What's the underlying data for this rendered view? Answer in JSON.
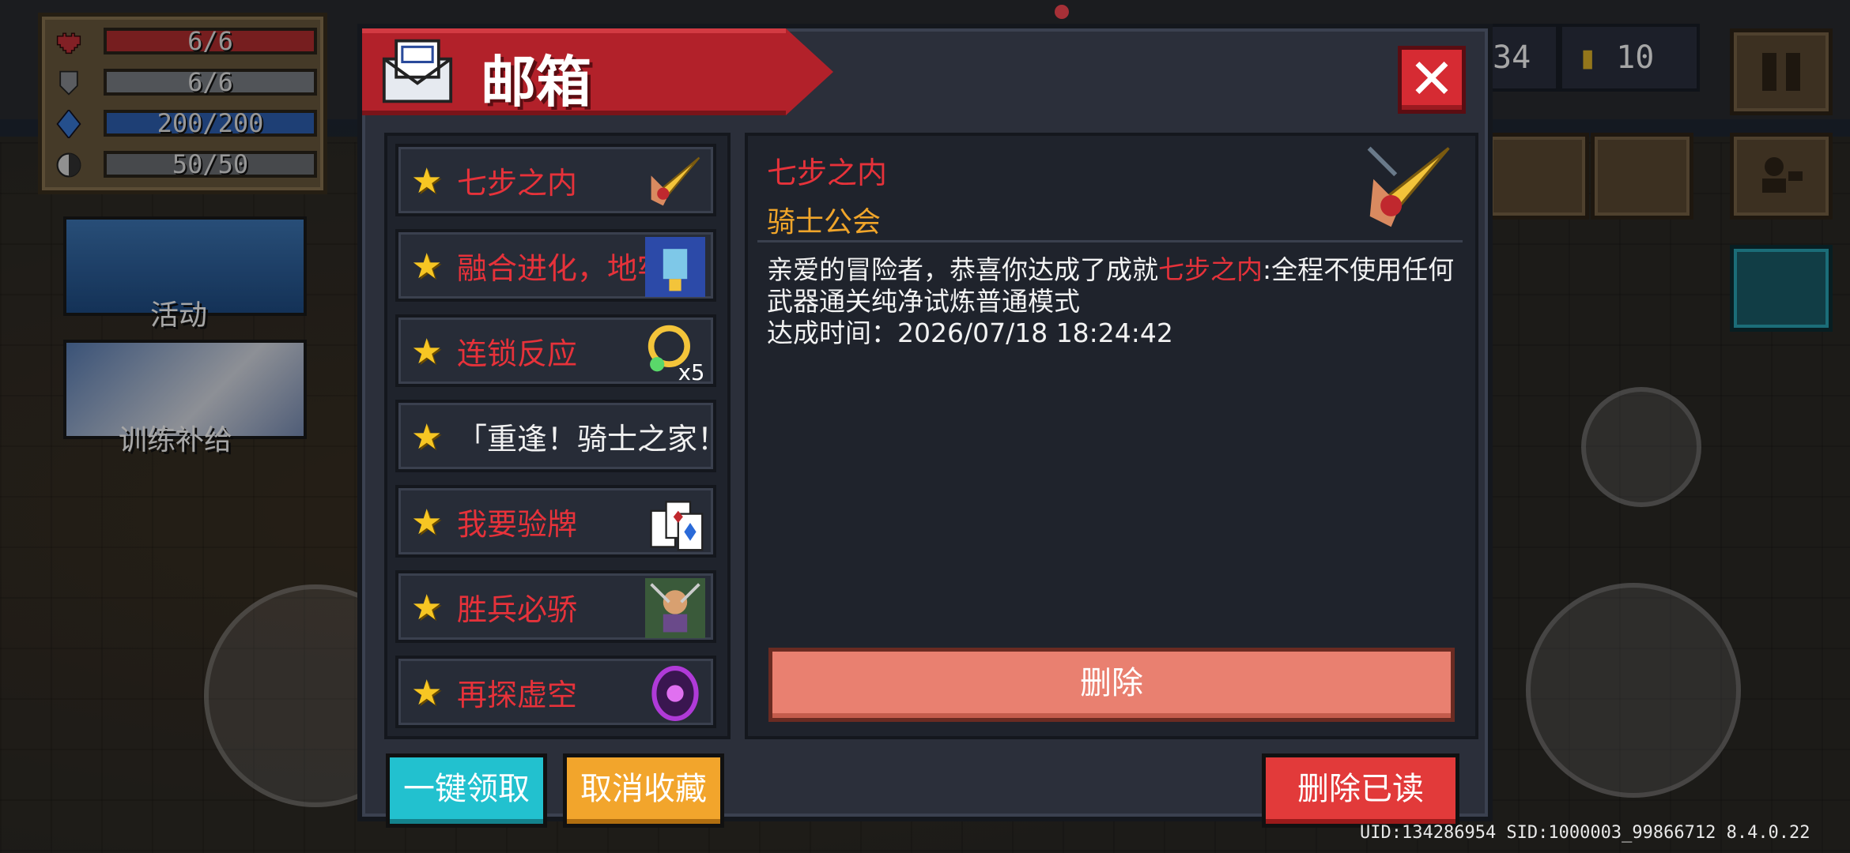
{
  "hud": {
    "stats": [
      {
        "icon": "heart-icon",
        "value": "6/6",
        "color": "#b52e30"
      },
      {
        "icon": "shield-icon",
        "value": "6/6",
        "color": "#7d8187"
      },
      {
        "icon": "energy-gem-icon",
        "value": "200/200",
        "color": "#2f62b4"
      },
      {
        "icon": "cooldown-icon",
        "value": "50/50",
        "color": "#6e7176"
      }
    ],
    "banners": [
      {
        "label": "活动"
      },
      {
        "label": "训练补给"
      }
    ],
    "gems": "34",
    "coins": "10"
  },
  "mailbox": {
    "title": "邮箱",
    "close_label": "✕",
    "mail_list": [
      {
        "title": "七步之内",
        "color": "red",
        "thumb": "sword-slash-icon"
      },
      {
        "title": "融合进化，地牢",
        "color": "red",
        "thumb": "robot-card-icon"
      },
      {
        "title": "连锁反应",
        "color": "red",
        "thumb": "chain-x5-icon"
      },
      {
        "title": "「重逢！骑士之家！",
        "color": "white",
        "thumb": ""
      },
      {
        "title": "我要验牌",
        "color": "red",
        "thumb": "cards-icon"
      },
      {
        "title": "胜兵必骄",
        "color": "red",
        "thumb": "soldier-icon"
      },
      {
        "title": "再探虚空",
        "color": "red",
        "thumb": "void-portal-icon"
      }
    ],
    "detail": {
      "title": "七步之内",
      "sender": "骑士公会",
      "body_prefix": "亲爱的冒险者，恭喜你达成了成就",
      "body_highlight": "七步之内",
      "body_suffix": ":全程不使用任何武器通关纯净试炼普通模式",
      "time_label": "达成时间：2026/07/18 18:24:42",
      "delete_label": "删除"
    },
    "buttons": {
      "claim_all": "一键领取",
      "unfavorite": "取消收藏",
      "delete_read": "删除已读"
    }
  },
  "footer": {
    "uid": "UID:134286954 SID:1000003_99866712 8.4.0.22"
  }
}
